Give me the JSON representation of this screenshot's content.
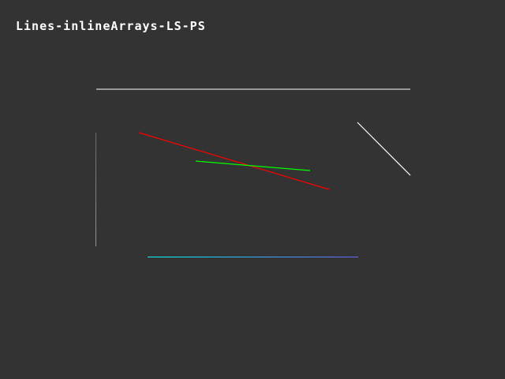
{
  "window": {
    "title": "Lines-inlineArrays-LS-PS",
    "background": "#333333"
  },
  "lines": [
    {
      "id": "top-horizontal-line",
      "from": "#ffffff",
      "to": "#ffffff"
    },
    {
      "id": "diagonal-white-line",
      "from": "#ffffff",
      "to": "#ffffff"
    },
    {
      "id": "red-line",
      "from": "#ff0000",
      "to": "#ff0000"
    },
    {
      "id": "green-line",
      "from": "#00ff00",
      "to": "#00ff00"
    },
    {
      "id": "left-vertical-line",
      "from": "#5555ff",
      "to": "#8888ff"
    },
    {
      "id": "bottom-gradient-line",
      "from": "#00ffff",
      "to": "#6666ff"
    }
  ]
}
